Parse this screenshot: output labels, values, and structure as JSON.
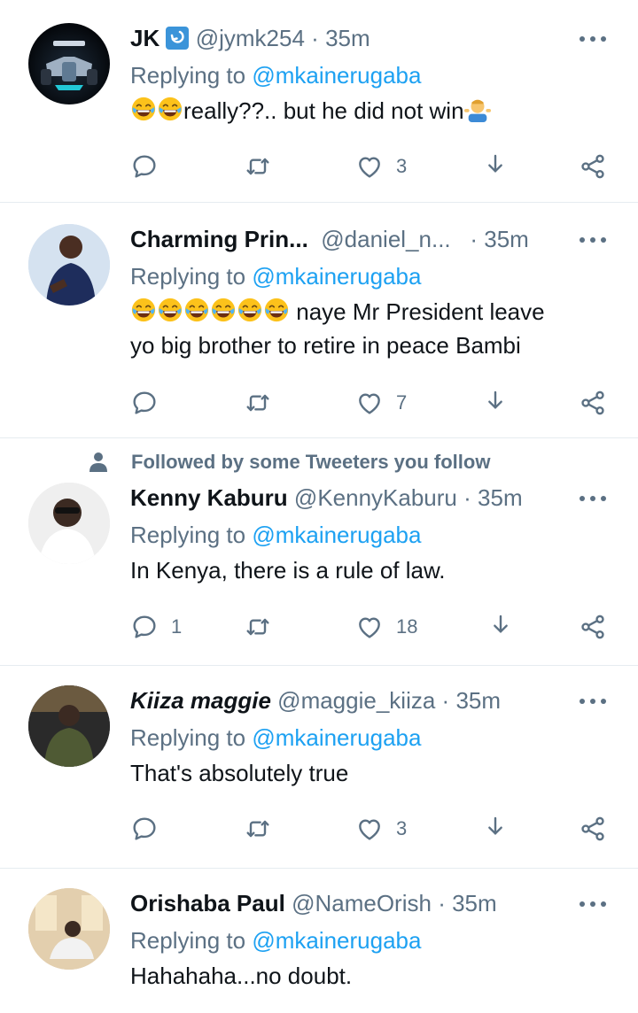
{
  "tweets": [
    {
      "name": "JK",
      "handle": "@jymk254",
      "sep": "·",
      "time": "35m",
      "replying_label": "Replying to",
      "replying_to": "@mkainerugaba",
      "text": "really??.. but he did not win",
      "reply_count": "",
      "like_count": "3"
    },
    {
      "name": "Charming Prin...",
      "handle": "@daniel_n...",
      "sep": "·",
      "time": "35m",
      "replying_label": "Replying to",
      "replying_to": "@mkainerugaba",
      "text_line1": "naye Mr President leave",
      "text_line2": "yo big brother to retire in peace Bambi",
      "reply_count": "",
      "like_count": "7"
    },
    {
      "social_context": "Followed by some Tweeters you follow",
      "name": "Kenny Kaburu",
      "handle": "@KennyKaburu",
      "sep": "·",
      "time": "35m",
      "replying_label": "Replying to",
      "replying_to": "@mkainerugaba",
      "text": "In Kenya, there is a rule of law.",
      "reply_count": "1",
      "like_count": "18"
    },
    {
      "name": "Kiiza maggie",
      "handle": "@maggie_kiiza",
      "sep": "·",
      "time": "35m",
      "replying_label": "Replying to",
      "replying_to": "@mkainerugaba",
      "text": "That's absolutely true",
      "reply_count": "",
      "like_count": "3"
    },
    {
      "name": "Orishaba Paul",
      "handle": "@NameOrish",
      "sep": "·",
      "time": "35m",
      "replying_label": "Replying to",
      "replying_to": "@mkainerugaba",
      "text": "Hahahaha...no doubt."
    }
  ],
  "colors": {
    "accent": "#1da1f2",
    "secondary_text": "#5b7083",
    "divider": "#e6ecf0"
  },
  "icons": [
    "reply-icon",
    "retweet-icon",
    "like-icon",
    "bookmark-icon",
    "share-icon",
    "more-icon",
    "person-icon",
    "laughing-emoji",
    "shrug-emoji",
    "retweet-badge-icon"
  ]
}
